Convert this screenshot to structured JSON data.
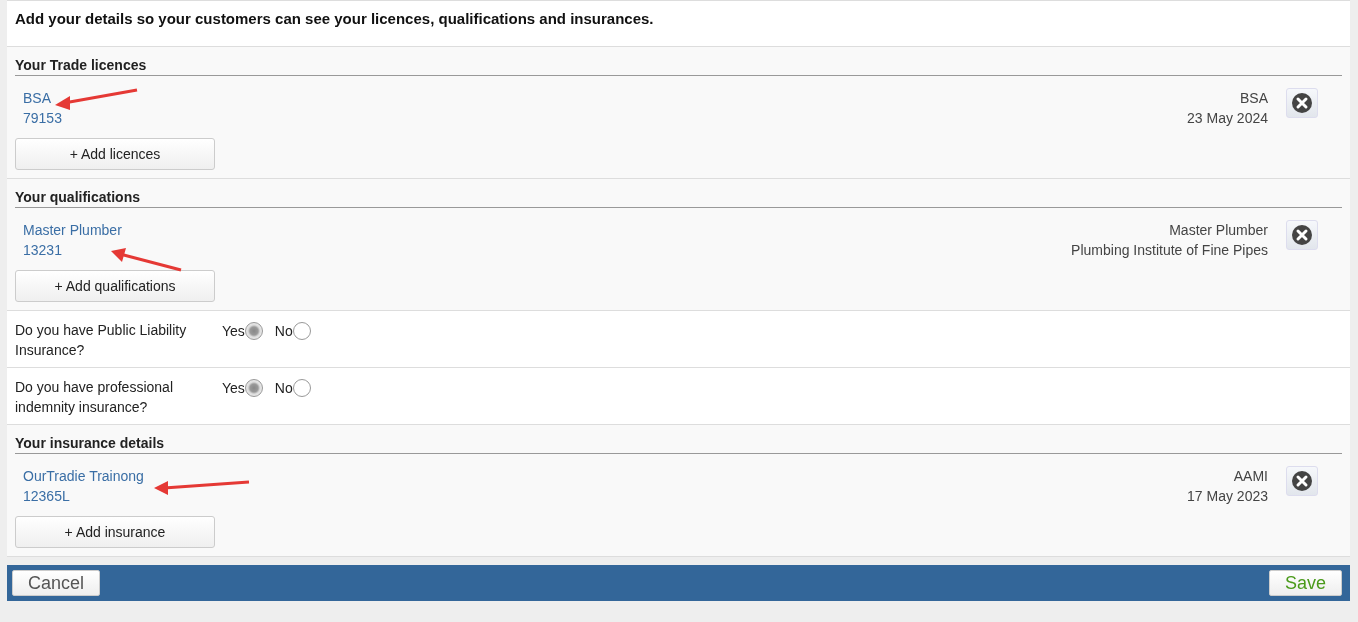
{
  "intro": "Add your details so your customers can see your licences, qualifications and insurances.",
  "sections": [
    {
      "kind": "list",
      "title": "Your Trade licences",
      "items": [
        {
          "name": "BSA",
          "number": "79153",
          "issuer": "BSA",
          "detail": "23 May 2024"
        }
      ],
      "add_button": "+ Add licences"
    },
    {
      "kind": "list",
      "title": "Your qualifications",
      "items": [
        {
          "name": "Master Plumber",
          "number": "13231",
          "issuer": "Master Plumber",
          "detail": "Plumbing Institute of Fine Pipes"
        }
      ],
      "add_button": "+ Add qualifications"
    },
    {
      "kind": "question",
      "question": "Do you have Public Liability Insurance?",
      "options": [
        {
          "label": "Yes",
          "selected": true
        },
        {
          "label": "No",
          "selected": false
        }
      ]
    },
    {
      "kind": "question",
      "question": "Do you have professional indemnity insurance?",
      "options": [
        {
          "label": "Yes",
          "selected": true
        },
        {
          "label": "No",
          "selected": false
        }
      ]
    },
    {
      "kind": "list",
      "title": "Your insurance details",
      "items": [
        {
          "name": "OurTradie Trainong",
          "number": "12365L",
          "issuer": "AAMI",
          "detail": "17 May 2023"
        }
      ],
      "add_button": "+ Add insurance"
    }
  ],
  "footer": {
    "cancel": "Cancel",
    "save": "Save"
  }
}
